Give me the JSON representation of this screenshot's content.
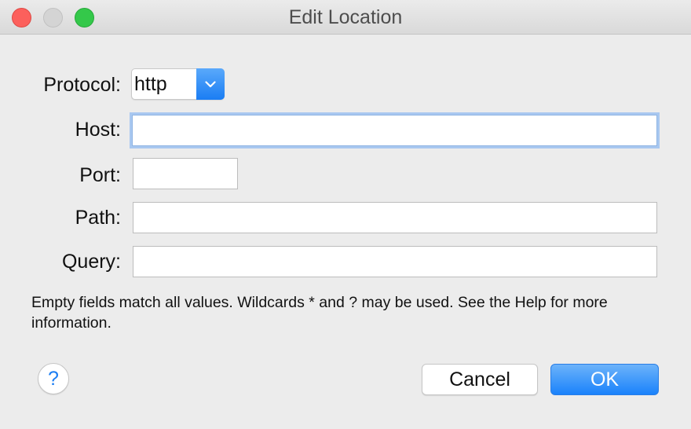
{
  "window": {
    "title": "Edit Location"
  },
  "form": {
    "protocol": {
      "label": "Protocol:",
      "value": "http"
    },
    "host": {
      "label": "Host:",
      "value": ""
    },
    "port": {
      "label": "Port:",
      "value": ""
    },
    "path": {
      "label": "Path:",
      "value": ""
    },
    "query": {
      "label": "Query:",
      "value": ""
    }
  },
  "note": "Empty fields match all values. Wildcards * and ? may be used. See the Help for more information.",
  "buttons": {
    "help": "?",
    "cancel": "Cancel",
    "ok": "OK"
  },
  "icons": {
    "select_arrow": "chevron-down-icon",
    "help": "help-icon"
  },
  "colors": {
    "accent": "#1a7df3",
    "close": "#fc605c",
    "minimize": "#d4d4d4",
    "zoom": "#34c84a",
    "background": "#ececec"
  }
}
